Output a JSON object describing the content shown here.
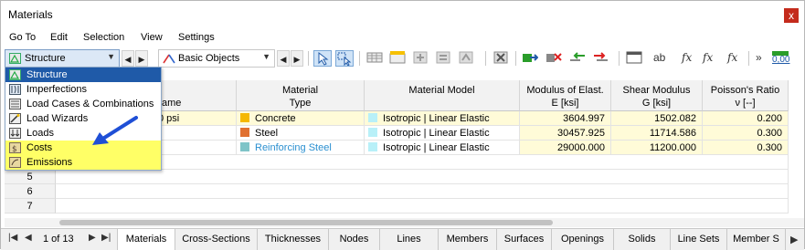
{
  "window": {
    "title": "Materials",
    "close_glyph": "x"
  },
  "menu": [
    "Go To",
    "Edit",
    "Selection",
    "View",
    "Settings"
  ],
  "toolbar": {
    "nav_combo_value": "Structure",
    "filter_combo_value": "Basic Objects",
    "fx_label": "fx",
    "ab_label": "ab",
    "more_glyph": "»",
    "decimal_label": "0,00"
  },
  "dropdown": {
    "items": [
      {
        "label": "Structure",
        "icon": "structure-icon",
        "state": "selected"
      },
      {
        "label": "Imperfections",
        "icon": "imperfections-icon",
        "state": "normal"
      },
      {
        "label": "Load Cases & Combinations",
        "icon": "load-cases-icon",
        "state": "normal"
      },
      {
        "label": "Load Wizards",
        "icon": "load-wizards-icon",
        "state": "normal"
      },
      {
        "label": "Loads",
        "icon": "loads-icon",
        "state": "normal"
      },
      {
        "label": "Costs",
        "icon": "costs-icon",
        "state": "highlighted"
      },
      {
        "label": "Emissions",
        "icon": "emissions-icon",
        "state": "highlighted"
      }
    ],
    "pointer_color": "#1f4fd6"
  },
  "table": {
    "headers": {
      "name_partial": "ame",
      "material_type": [
        "Material",
        "Type"
      ],
      "material_model": [
        "",
        "Material Model"
      ],
      "modulus_e": [
        "Modulus of Elast.",
        "E [ksi]"
      ],
      "shear_g": [
        "Shear Modulus",
        "G [ksi]"
      ],
      "poisson": [
        "Poisson's Ratio",
        "ν [--]"
      ]
    },
    "rows": [
      {
        "no": "",
        "name_partial": "0 psi",
        "type": "Concrete",
        "type_color": "#f5b800",
        "model": "Isotropic | Linear Elastic",
        "e": "3604.997",
        "g": "1502.082",
        "nu": "0.200",
        "type_link": false
      },
      {
        "no": "",
        "name_partial": "",
        "type": "Steel",
        "type_color": "#e07030",
        "model": "Isotropic | Linear Elastic",
        "e": "30457.925",
        "g": "11714.586",
        "nu": "0.300",
        "type_link": false
      },
      {
        "no": "",
        "name_partial": "",
        "type": "Reinforcing Steel",
        "type_color": "#7fc4c8",
        "model": "Isotropic | Linear Elastic",
        "e": "29000.000",
        "g": "11200.000",
        "nu": "0.300",
        "type_link": true
      },
      {
        "no": "",
        "name_partial": "",
        "type": "",
        "model": "",
        "e": "",
        "g": "",
        "nu": ""
      },
      {
        "no": "5",
        "name_partial": "",
        "type": "",
        "model": "",
        "e": "",
        "g": "",
        "nu": ""
      },
      {
        "no": "6",
        "name_partial": "",
        "type": "",
        "model": "",
        "e": "",
        "g": "",
        "nu": ""
      },
      {
        "no": "7",
        "name_partial": "",
        "type": "",
        "model": "",
        "e": "",
        "g": "",
        "nu": ""
      }
    ],
    "model_swatch_color": "#b8f0f8"
  },
  "pager": {
    "text": "1 of 13"
  },
  "tabs": [
    "Materials",
    "Cross-Sections",
    "Thicknesses",
    "Nodes",
    "Lines",
    "Members",
    "Surfaces",
    "Openings",
    "Solids",
    "Line Sets",
    "Member S"
  ],
  "active_tab": "Materials"
}
